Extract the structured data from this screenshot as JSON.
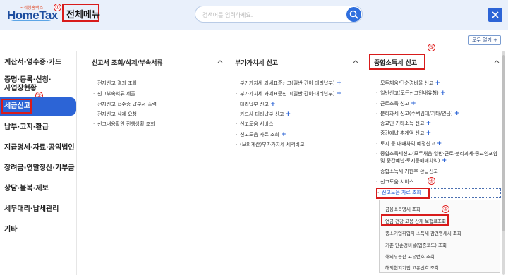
{
  "header": {
    "logo_small": "국세청홈택스",
    "logo_main": "HomeTax",
    "menu_title": "전체메뉴",
    "search_placeholder": "검색어를 입력하세요.",
    "expand_all": "모두 열기 +"
  },
  "annotations": [
    "①",
    "②",
    "③",
    "④",
    "⑤"
  ],
  "sidebar": {
    "items": [
      {
        "label": "계산서·영수증·카드"
      },
      {
        "label": "증명·등록·신청·"
      },
      {
        "label": "사업장현황"
      },
      {
        "label": "세금신고"
      },
      {
        "label": "납부·고지·환급"
      },
      {
        "label": "지급명세·자료·공익법인"
      },
      {
        "label": "장려금·연말정산·기부금"
      },
      {
        "label": "상담·불복·제보"
      },
      {
        "label": "세무대리·납세관리"
      },
      {
        "label": "기타"
      }
    ]
  },
  "columns": [
    {
      "title": "신고서 조회/삭제/부속서류",
      "items": [
        {
          "label": "전자신고 결과 조회"
        },
        {
          "label": "신고부속서류 제출"
        },
        {
          "label": "전자신고 접수증·납부서 출력"
        },
        {
          "label": "전자신고 삭제 요청"
        },
        {
          "label": "신고내용확인 진행상황 조회"
        }
      ]
    },
    {
      "title": "부가가치세 신고",
      "items": [
        {
          "label": "부가가치세 과세표준신고(일반·간이·대리납부)"
        },
        {
          "label": "부가가치세 과세표준신고(일반·간이·대리납부)"
        },
        {
          "label": "대리납부 신고"
        },
        {
          "label": "카드사 대리납부 신고"
        },
        {
          "label": "신고도움 서비스"
        },
        {
          "label": "신고도움 자료 조회"
        },
        {
          "label": "(모의계산)부가가치세 세액비교"
        }
      ]
    },
    {
      "title": "종합소득세 신고",
      "items": [
        {
          "label": "모두채움/단순경비율 신고"
        },
        {
          "label": "일반신고(모든신고안내유형)"
        },
        {
          "label": "근로소득 신고"
        },
        {
          "label": "분리과세 신고(주택임대/기타/연금)"
        },
        {
          "label": "종교인 기타소득 신고"
        },
        {
          "label": "중간예납 추계액 신고"
        },
        {
          "label": "토지 등 매매차익 예정신고"
        },
        {
          "label": "종합소득세신고(모두채움·일반·근로·분리과세·종교인포함"
        },
        {
          "label": "및 중간예납·토지등매매차익)"
        },
        {
          "label": "종합소득세 기한후 환급신고"
        },
        {
          "label": "신고도움 서비스"
        },
        {
          "label": "신고도움 자료 조회"
        }
      ],
      "submenu": [
        {
          "label": "금융소득명세 조회"
        },
        {
          "label": "연금·건강·고용·산재 보험료조회"
        },
        {
          "label": "중소기업취업자 소득세 감면명세서 조회"
        },
        {
          "label": "기준·단순경비율(업종코드) 조회"
        },
        {
          "label": "해외부동산 고유번호 조회"
        },
        {
          "label": "해외현지기업 고유번호 조회"
        }
      ]
    }
  ],
  "colors": {
    "accent": "#2c64d6",
    "annotation": "#d81b1b",
    "header_bg": "#e9f0fb"
  }
}
